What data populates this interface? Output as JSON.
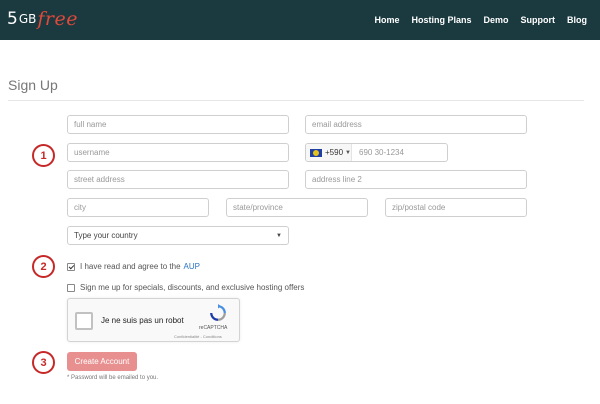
{
  "header": {
    "logo": {
      "number": "5",
      "gb": "GB",
      "free": "free"
    },
    "nav": [
      "Home",
      "Hosting Plans",
      "Demo",
      "Support",
      "Blog"
    ]
  },
  "page": {
    "title": "Sign Up"
  },
  "form": {
    "full_name": {
      "placeholder": "full name",
      "value": ""
    },
    "email": {
      "placeholder": "email address",
      "value": ""
    },
    "username": {
      "placeholder": "username",
      "value": ""
    },
    "phone": {
      "dial_code": "+590",
      "placeholder": "690 30-1234",
      "value": ""
    },
    "street": {
      "placeholder": "street address",
      "value": ""
    },
    "address2": {
      "placeholder": "address line 2",
      "value": ""
    },
    "city": {
      "placeholder": "city",
      "value": ""
    },
    "state": {
      "placeholder": "state/province",
      "value": ""
    },
    "zip": {
      "placeholder": "zip/postal code",
      "value": ""
    },
    "country": {
      "selected": "Type your country"
    },
    "agree": {
      "label": "I have read and agree to the",
      "link": "AUP",
      "checked": true
    },
    "newsletter": {
      "label": "Sign me up for specials, discounts, and exclusive hosting offers",
      "checked": false
    },
    "recaptcha": {
      "label": "Je ne suis pas un robot",
      "brand": "reCAPTCHA",
      "terms": "Confidentialité - Conditions"
    },
    "submit_label": "Create Account",
    "note": "* Password will be emailed to you."
  },
  "annotations": [
    "1",
    "2",
    "3"
  ],
  "colors": {
    "navbar": "#1b3a40",
    "logo_accent": "#e0493a",
    "step_circle": "#c62828",
    "button": "#e89090",
    "link": "#2a72c2"
  }
}
